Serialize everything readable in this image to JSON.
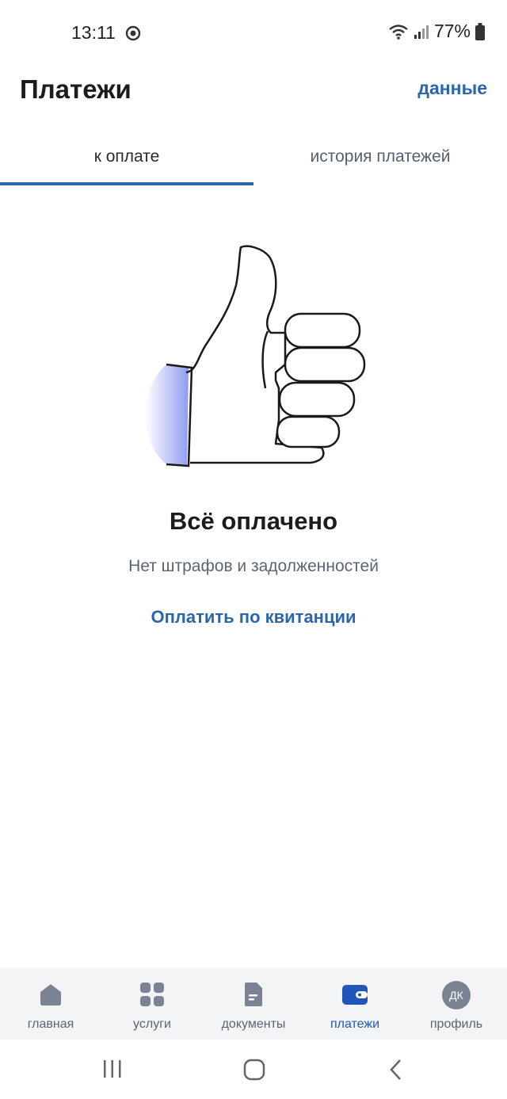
{
  "status_bar": {
    "time": "13:11",
    "battery": "77%"
  },
  "header": {
    "title": "Платежи",
    "action_label": "данные"
  },
  "tabs": [
    {
      "label": "к оплате",
      "active": true
    },
    {
      "label": "история платежей",
      "active": false
    }
  ],
  "empty_state": {
    "illustration_icon": "thumbs-up-icon",
    "title": "Всё оплачено",
    "subtitle": "Нет штрафов и задолженностей",
    "link_label": "Оплатить по квитанции"
  },
  "bottom_nav": {
    "items": [
      {
        "label": "главная",
        "icon": "home-icon"
      },
      {
        "label": "услуги",
        "icon": "grid-icon"
      },
      {
        "label": "документы",
        "icon": "document-icon"
      },
      {
        "label": "платежи",
        "icon": "wallet-icon",
        "active": true
      },
      {
        "label": "профиль",
        "icon": "avatar",
        "initials": "ДК"
      }
    ]
  },
  "colors": {
    "accent": "#2b66ad",
    "active_nav": "#2056b8",
    "inactive_icon": "#7a8294",
    "nav_background": "#f3f4f6"
  }
}
